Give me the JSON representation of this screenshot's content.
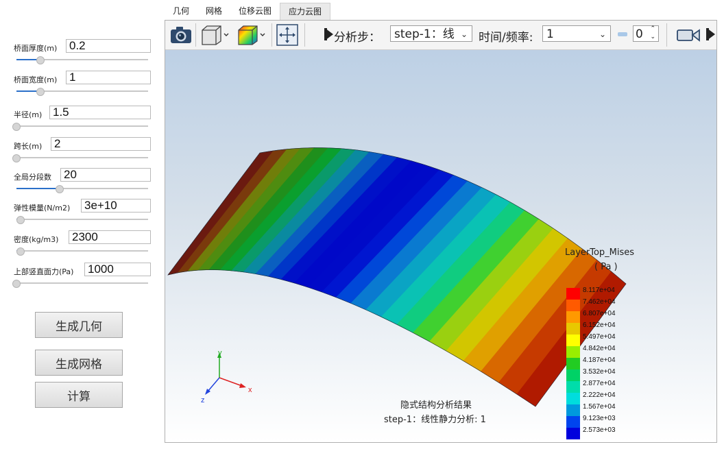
{
  "tabs": [
    "几何",
    "网格",
    "位移云图",
    "应力云图"
  ],
  "active_tab": 3,
  "params": [
    {
      "label": "桥面厚度(m)",
      "value": "0.2",
      "slider": 0.18
    },
    {
      "label": "桥面宽度(m)",
      "value": "1",
      "slider": 0.18
    },
    {
      "label": "半径(m)",
      "value": "1.5",
      "slider": 0.0
    },
    {
      "label": "跨长(m)",
      "value": "2",
      "slider": 0.0
    },
    {
      "label": "全局分段数",
      "value": "20",
      "slider": 0.33
    },
    {
      "label": "弹性模量(N/m2)",
      "value": "3e+10",
      "slider": 0.03
    },
    {
      "label": "密度(kg/m3)",
      "value": "2300",
      "slider": 0.03
    },
    {
      "label": "上部竖直面力(Pa)",
      "value": "1000",
      "slider": 0.0
    }
  ],
  "buttons": {
    "gen_geometry": "生成几何",
    "gen_mesh": "生成网格",
    "compute": "计算"
  },
  "toolbar": {
    "step_label": "分析步：",
    "step_value": "step-1：线",
    "time_label": "时间/频率:",
    "time_value": "1",
    "frame_value": "0"
  },
  "legend": {
    "title": "LayerTop_Mises",
    "unit": "( Pa )",
    "values": [
      "8.117e+04",
      "7.462e+04",
      "6.807e+04",
      "6.152e+04",
      "5.497e+04",
      "4.842e+04",
      "4.187e+04",
      "3.532e+04",
      "2.877e+04",
      "2.222e+04",
      "1.567e+04",
      "9.123e+03",
      "2.573e+03"
    ],
    "colors": [
      "#ff0000",
      "#ff5a00",
      "#ff9900",
      "#e8c800",
      "#ffff00",
      "#99ee00",
      "#22cc22",
      "#00d266",
      "#00ddaa",
      "#00dddd",
      "#0099dd",
      "#0044ee",
      "#0000dd"
    ]
  },
  "caption": {
    "line1": "隐式结构分析结果",
    "line2": "step-1：线性静力分析: 1"
  },
  "axes": {
    "x": "x",
    "y": "y",
    "z": "z"
  }
}
